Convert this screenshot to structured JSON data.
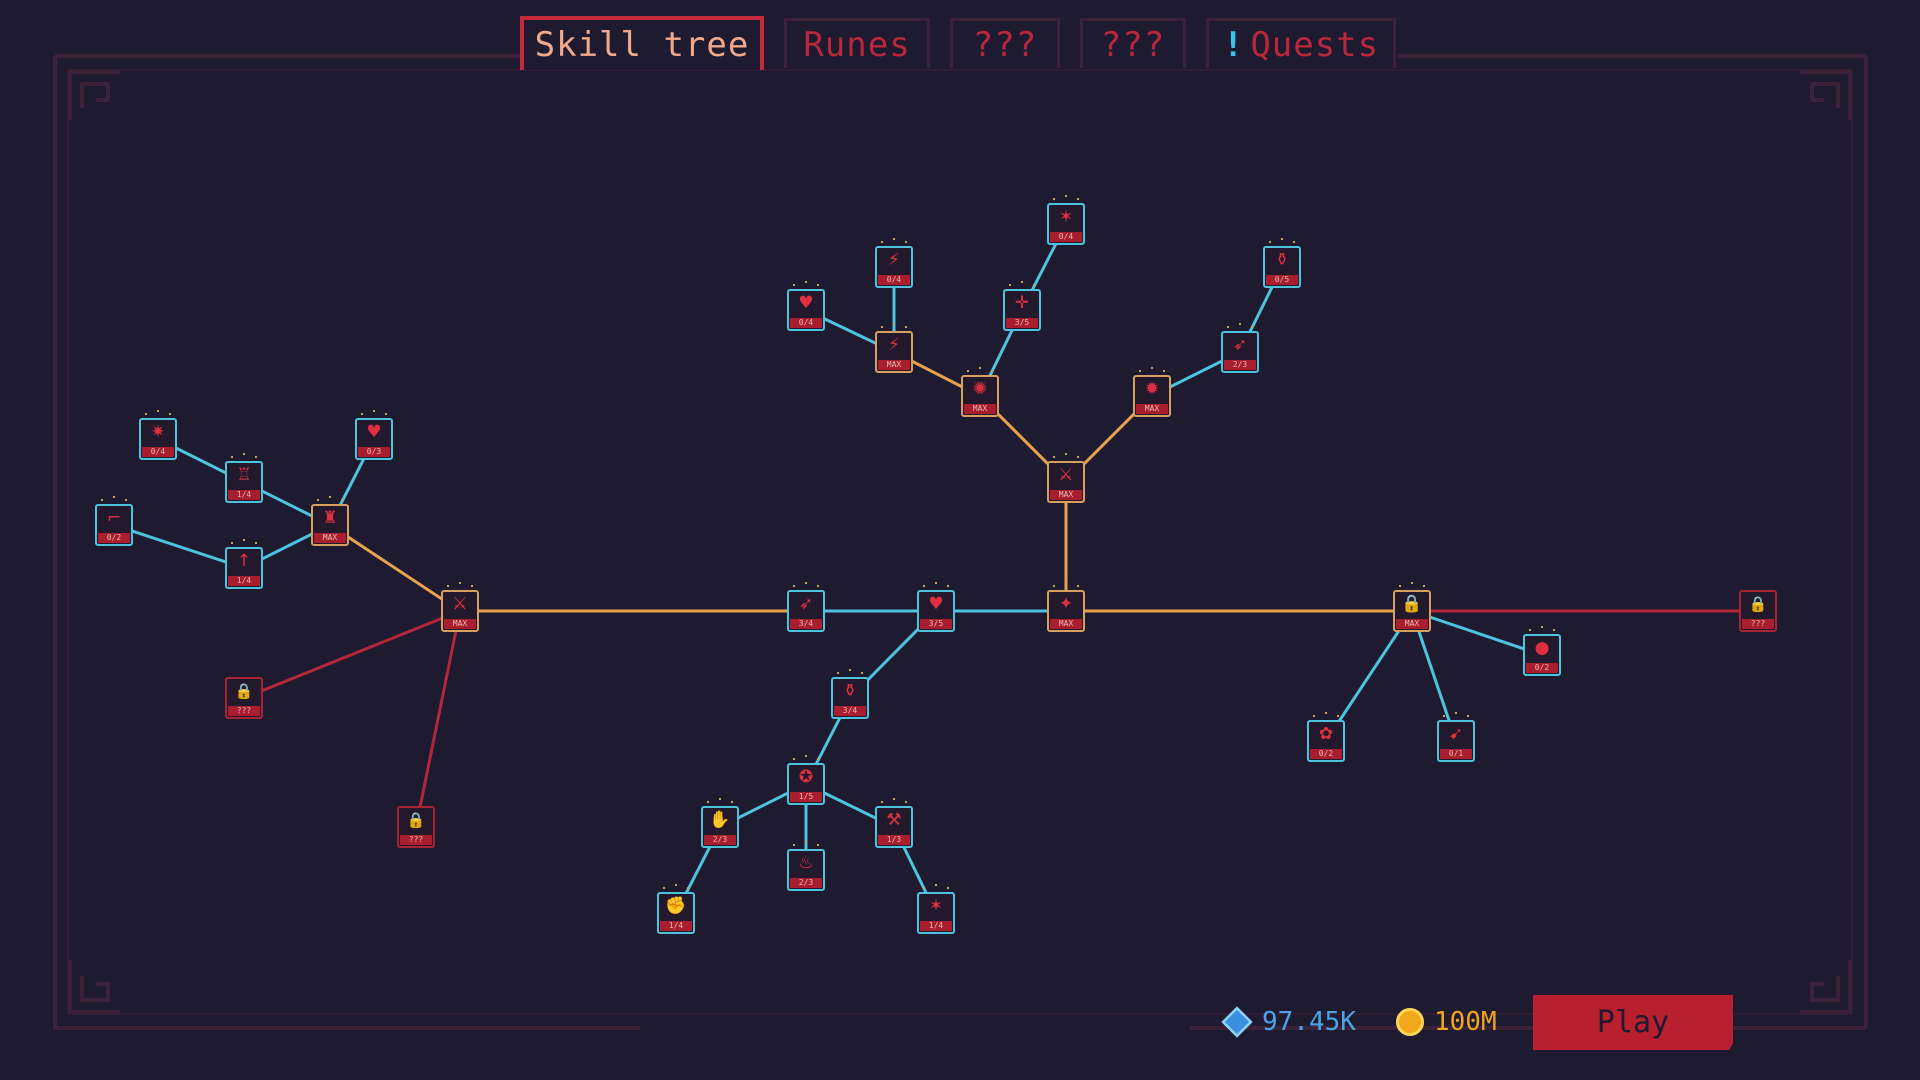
{
  "tabs": [
    {
      "label": "Skill tree",
      "active": true
    },
    {
      "label": "Runes",
      "active": false
    },
    {
      "label": "???",
      "active": false
    },
    {
      "label": "???",
      "active": false
    },
    {
      "label": "Quests",
      "active": false,
      "notification": "!"
    }
  ],
  "currency": {
    "gems": "97.45K",
    "gold": "100M"
  },
  "play_label": "Play",
  "colors": {
    "background": "#1e1a30",
    "edge_active": "#e8a24e",
    "edge_available": "#4ec3dd",
    "edge_locked": "#b3273a",
    "accent_red": "#b8202f"
  },
  "skill_tree": {
    "nodes": [
      {
        "id": "n1",
        "level": "MAX",
        "state": "maxed",
        "icon": "slash-icon"
      },
      {
        "id": "n2",
        "level": "3/4",
        "state": "available",
        "icon": "dash-icon"
      },
      {
        "id": "n3",
        "level": "3/5",
        "state": "available",
        "icon": "heart-icon"
      },
      {
        "id": "n4",
        "level": "MAX",
        "state": "maxed",
        "icon": "star-icon"
      },
      {
        "id": "n5",
        "level": "MAX",
        "state": "maxed",
        "icon": "sword-icon"
      },
      {
        "id": "n6",
        "level": "MAX",
        "state": "maxed",
        "icon": "burst-icon"
      },
      {
        "id": "n7",
        "level": "MAX",
        "state": "maxed",
        "icon": "beetle-icon"
      },
      {
        "id": "n8",
        "level": "MAX",
        "state": "maxed",
        "icon": "runner-icon"
      },
      {
        "id": "n9",
        "level": "0/4",
        "state": "available",
        "icon": "heart-plus-icon"
      },
      {
        "id": "n10",
        "level": "0/4",
        "state": "available",
        "icon": "double-runner-icon"
      },
      {
        "id": "n11",
        "level": "3/5",
        "state": "available",
        "icon": "crosshair-icon"
      },
      {
        "id": "n12",
        "level": "0/4",
        "state": "available",
        "icon": "claw-icon"
      },
      {
        "id": "n13",
        "level": "2/3",
        "state": "available",
        "icon": "dash-icon"
      },
      {
        "id": "n14",
        "level": "0/5",
        "state": "available",
        "icon": "potion-icon"
      },
      {
        "id": "n15",
        "level": "MAX",
        "state": "maxed",
        "icon": "lock-icon"
      },
      {
        "id": "n16",
        "level": "???",
        "state": "locked",
        "icon": "lock-icon"
      },
      {
        "id": "n17",
        "level": "0/2",
        "state": "available",
        "icon": "orb-icon"
      },
      {
        "id": "n18",
        "level": "0/2",
        "state": "available",
        "icon": "flower-icon"
      },
      {
        "id": "n19",
        "level": "0/1",
        "state": "available",
        "icon": "feather-icon"
      },
      {
        "id": "n20",
        "level": "3/4",
        "state": "available",
        "icon": "potion-icon"
      },
      {
        "id": "n21",
        "level": "1/5",
        "state": "available",
        "icon": "figure-icon"
      },
      {
        "id": "n22",
        "level": "2/3",
        "state": "available",
        "icon": "hand-icon"
      },
      {
        "id": "n23",
        "level": "1/4",
        "state": "available",
        "icon": "hand-burst-icon"
      },
      {
        "id": "n24",
        "level": "2/3",
        "state": "available",
        "icon": "flame-icon"
      },
      {
        "id": "n25",
        "level": "1/3",
        "state": "available",
        "icon": "axe-icon"
      },
      {
        "id": "n26",
        "level": "1/4",
        "state": "available",
        "icon": "claw-icon"
      },
      {
        "id": "n27",
        "level": "MAX",
        "state": "maxed",
        "icon": "warrior-icon"
      },
      {
        "id": "n28",
        "level": "0/3",
        "state": "available",
        "icon": "heart-plus-icon"
      },
      {
        "id": "n29",
        "level": "1/4",
        "state": "available",
        "icon": "totem-icon"
      },
      {
        "id": "n30",
        "level": "0/4",
        "state": "available",
        "icon": "splash-icon"
      },
      {
        "id": "n31",
        "level": "1/4",
        "state": "available",
        "icon": "arrow-up-icon"
      },
      {
        "id": "n32",
        "level": "0/2",
        "state": "available",
        "icon": "gun-icon"
      },
      {
        "id": "n33",
        "level": "???",
        "state": "locked",
        "icon": "lock-icon"
      },
      {
        "id": "n34",
        "level": "???",
        "state": "locked",
        "icon": "lock-icon"
      }
    ],
    "edges": [
      {
        "from": "n1",
        "to": "n2",
        "type": "active"
      },
      {
        "from": "n2",
        "to": "n3",
        "type": "available"
      },
      {
        "from": "n3",
        "to": "n4",
        "type": "available"
      },
      {
        "from": "n4",
        "to": "n5",
        "type": "active"
      },
      {
        "from": "n5",
        "to": "n6",
        "type": "active"
      },
      {
        "from": "n5",
        "to": "n7",
        "type": "active"
      },
      {
        "from": "n6",
        "to": "n8",
        "type": "active"
      },
      {
        "from": "n8",
        "to": "n9",
        "type": "available"
      },
      {
        "from": "n8",
        "to": "n10",
        "type": "available"
      },
      {
        "from": "n6",
        "to": "n11",
        "type": "available"
      },
      {
        "from": "n11",
        "to": "n12",
        "type": "available"
      },
      {
        "from": "n7",
        "to": "n13",
        "type": "available"
      },
      {
        "from": "n13",
        "to": "n14",
        "type": "available"
      },
      {
        "from": "n4",
        "to": "n15",
        "type": "active"
      },
      {
        "from": "n15",
        "to": "n16",
        "type": "locked"
      },
      {
        "from": "n15",
        "to": "n17",
        "type": "available"
      },
      {
        "from": "n15",
        "to": "n18",
        "type": "available"
      },
      {
        "from": "n15",
        "to": "n19",
        "type": "available"
      },
      {
        "from": "n3",
        "to": "n20",
        "type": "available"
      },
      {
        "from": "n20",
        "to": "n21",
        "type": "available"
      },
      {
        "from": "n21",
        "to": "n22",
        "type": "available"
      },
      {
        "from": "n22",
        "to": "n23",
        "type": "available"
      },
      {
        "from": "n21",
        "to": "n24",
        "type": "available"
      },
      {
        "from": "n21",
        "to": "n25",
        "type": "available"
      },
      {
        "from": "n25",
        "to": "n26",
        "type": "available"
      },
      {
        "from": "n1",
        "to": "n27",
        "type": "active"
      },
      {
        "from": "n27",
        "to": "n28",
        "type": "available"
      },
      {
        "from": "n27",
        "to": "n29",
        "type": "available"
      },
      {
        "from": "n29",
        "to": "n30",
        "type": "available"
      },
      {
        "from": "n27",
        "to": "n31",
        "type": "available"
      },
      {
        "from": "n31",
        "to": "n32",
        "type": "available"
      },
      {
        "from": "n1",
        "to": "n33",
        "type": "locked"
      },
      {
        "from": "n1",
        "to": "n34",
        "type": "locked"
      }
    ]
  }
}
